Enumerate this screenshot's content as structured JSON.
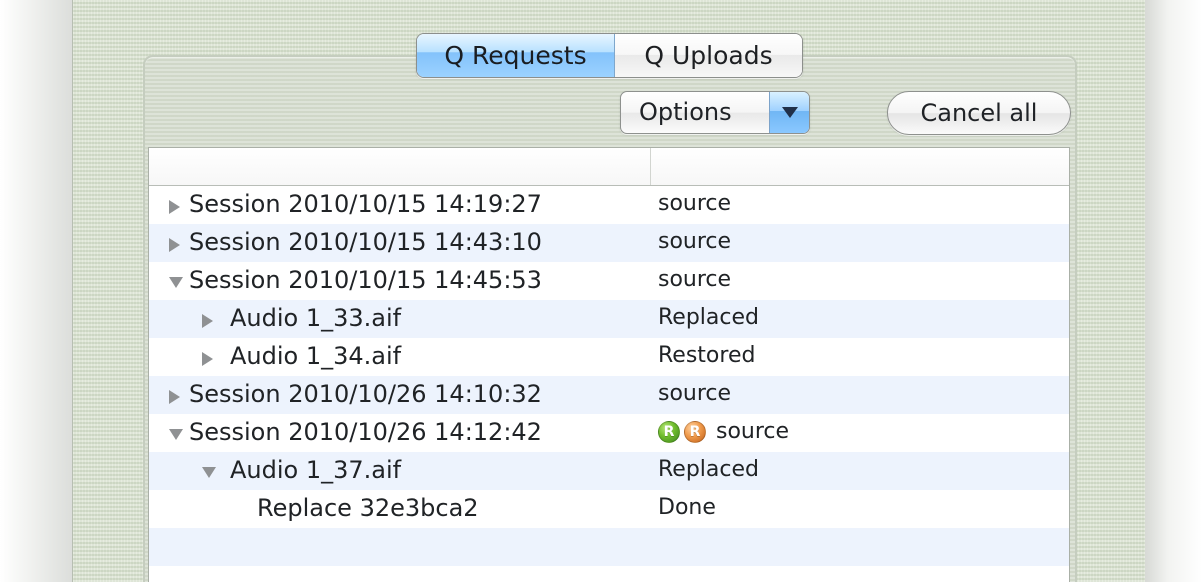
{
  "tabs": [
    {
      "label": "Q Requests",
      "selected": true
    },
    {
      "label": "Q Uploads",
      "selected": false
    }
  ],
  "controls": {
    "options_label": "Options",
    "cancel_all_label": "Cancel all"
  },
  "table": {
    "rows": [
      {
        "name": "Session 2010/10/15 14:19:27",
        "status": "source",
        "expanded": false,
        "level": 0,
        "alt": false
      },
      {
        "name": "Session 2010/10/15 14:43:10",
        "status": "source",
        "expanded": false,
        "level": 0,
        "alt": true
      },
      {
        "name": "Session 2010/10/15 14:45:53",
        "status": "source",
        "expanded": true,
        "level": 0,
        "alt": false
      },
      {
        "name": "Audio 1_33.aif",
        "status": "Replaced",
        "expanded": false,
        "level": 1,
        "alt": true
      },
      {
        "name": "Audio 1_34.aif",
        "status": "Restored",
        "expanded": false,
        "level": 1,
        "alt": false
      },
      {
        "name": "Session 2010/10/26 14:10:32",
        "status": "source",
        "expanded": false,
        "level": 0,
        "alt": true
      },
      {
        "name": "Session 2010/10/26 14:12:42",
        "status": "source",
        "expanded": true,
        "level": 0,
        "alt": false,
        "badges": [
          "R",
          "R"
        ]
      },
      {
        "name": "Audio 1_37.aif",
        "status": "Replaced",
        "expanded": true,
        "level": 1,
        "alt": true
      },
      {
        "name": "Replace 32e3bca2",
        "status": "Done",
        "expanded": null,
        "level": 2,
        "alt": false
      }
    ]
  },
  "icons": {
    "collapsed_disclosure": "triangle-right-icon",
    "expanded_disclosure": "triangle-down-icon",
    "dropdown": "chevron-down-icon",
    "badge_green": "green-r-badge-icon",
    "badge_orange": "orange-r-badge-icon"
  },
  "colors": {
    "accent_blue": "#8fc8ff",
    "row_alt": "#edf3fd",
    "window_green": "#dce4d3",
    "text": "#202326"
  }
}
